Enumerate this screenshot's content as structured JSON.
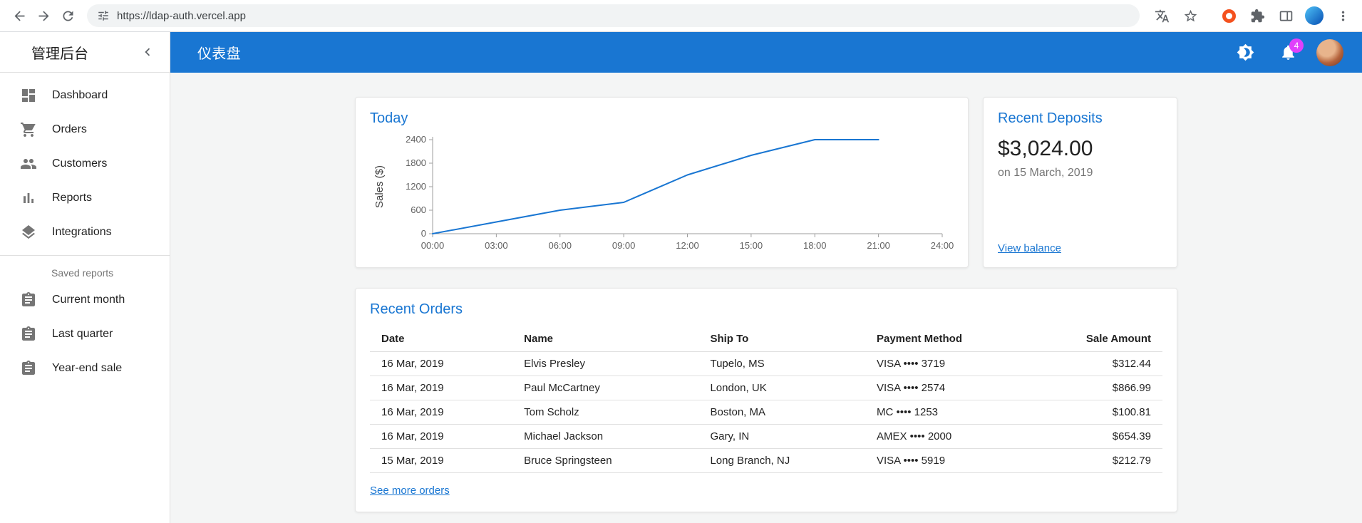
{
  "browser": {
    "url": "https://ldap-auth.vercel.app"
  },
  "sidebar": {
    "title": "管理后台",
    "items": [
      {
        "label": "Dashboard"
      },
      {
        "label": "Orders"
      },
      {
        "label": "Customers"
      },
      {
        "label": "Reports"
      },
      {
        "label": "Integrations"
      }
    ],
    "saved_reports_header": "Saved reports",
    "saved_reports": [
      {
        "label": "Current month"
      },
      {
        "label": "Last quarter"
      },
      {
        "label": "Year-end sale"
      }
    ]
  },
  "appbar": {
    "title": "仪表盘",
    "notification_count": "4"
  },
  "chart_data": {
    "type": "line",
    "title": "Today",
    "ylabel": "Sales ($)",
    "x": [
      "00:00",
      "03:00",
      "06:00",
      "09:00",
      "12:00",
      "15:00",
      "18:00",
      "21:00",
      "24:00"
    ],
    "values": [
      0,
      300,
      600,
      800,
      1500,
      2000,
      2400,
      2400,
      null
    ],
    "yticks": [
      0,
      600,
      1200,
      1800,
      2400
    ],
    "ylim": [
      0,
      2400
    ],
    "grid": false,
    "legend": "none",
    "line_color": "#1976d2"
  },
  "deposits_card": {
    "title": "Recent Deposits",
    "amount": "$3,024.00",
    "date": "on 15 March, 2019",
    "link": "View balance"
  },
  "orders_card": {
    "title": "Recent Orders",
    "columns": [
      "Date",
      "Name",
      "Ship To",
      "Payment Method",
      "Sale Amount"
    ],
    "rows": [
      {
        "date": "16 Mar, 2019",
        "name": "Elvis Presley",
        "ship_to": "Tupelo, MS",
        "payment": "VISA •••• 3719",
        "amount": "$312.44"
      },
      {
        "date": "16 Mar, 2019",
        "name": "Paul McCartney",
        "ship_to": "London, UK",
        "payment": "VISA •••• 2574",
        "amount": "$866.99"
      },
      {
        "date": "16 Mar, 2019",
        "name": "Tom Scholz",
        "ship_to": "Boston, MA",
        "payment": "MC •••• 1253",
        "amount": "$100.81"
      },
      {
        "date": "16 Mar, 2019",
        "name": "Michael Jackson",
        "ship_to": "Gary, IN",
        "payment": "AMEX •••• 2000",
        "amount": "$654.39"
      },
      {
        "date": "15 Mar, 2019",
        "name": "Bruce Springsteen",
        "ship_to": "Long Branch, NJ",
        "payment": "VISA •••• 5919",
        "amount": "$212.79"
      }
    ],
    "link": "See more orders"
  },
  "colors": {
    "primary": "#1976d2",
    "badge": "#e040fb",
    "background": "#f4f5f5",
    "link": "#1976d2"
  }
}
